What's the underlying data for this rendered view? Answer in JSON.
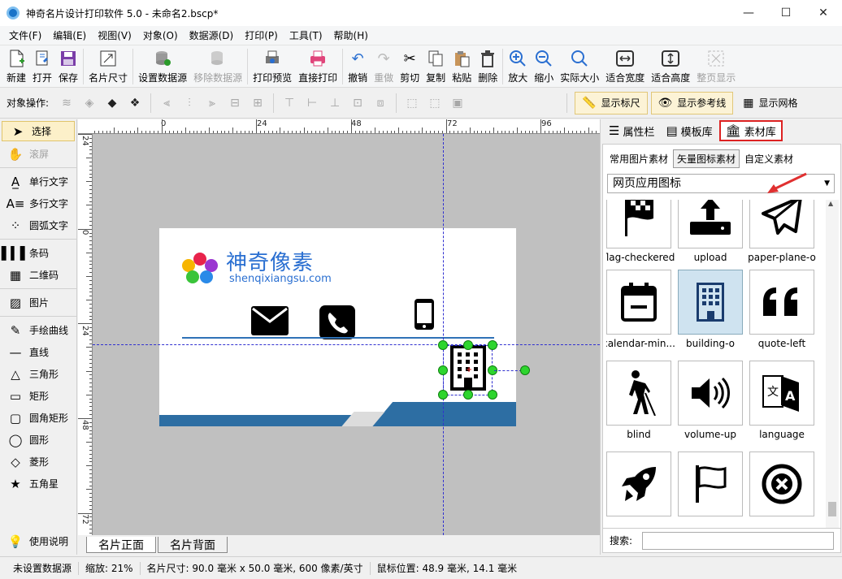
{
  "window": {
    "title": "神奇名片设计打印软件 5.0 - 未命名2.bscp*",
    "minimize": "—",
    "maximize": "☐",
    "close": "✕"
  },
  "menu": [
    "文件(F)",
    "编辑(E)",
    "视图(V)",
    "对象(O)",
    "数据源(D)",
    "打印(P)",
    "工具(T)",
    "帮助(H)"
  ],
  "toolbar": {
    "new": "新建",
    "open": "打开",
    "save": "保存",
    "card_size": "名片尺寸",
    "set_datasource": "设置数据源",
    "remove_datasource": "移除数据源",
    "print_preview": "打印预览",
    "direct_print": "直接打印",
    "undo": "撤销",
    "redo": "重做",
    "cut": "剪切",
    "copy": "复制",
    "paste": "粘贴",
    "delete": "删除",
    "zoom_in": "放大",
    "zoom_out": "缩小",
    "actual_size": "实际大小",
    "fit_width": "适合宽度",
    "fit_height": "适合高度",
    "fit_page": "整页显示"
  },
  "objbar": {
    "label": "对象操作:",
    "show_ruler": "显示标尺",
    "show_guides": "显示参考线",
    "show_grid": "显示网格"
  },
  "tools": {
    "select": "选择",
    "scroll": "滚屏",
    "single_text": "单行文字",
    "multi_text": "多行文字",
    "arc_text": "圆弧文字",
    "barcode": "条码",
    "qrcode": "二维码",
    "image": "图片",
    "freehand": "手绘曲线",
    "line": "直线",
    "triangle": "三角形",
    "rect": "矩形",
    "round_rect": "圆角矩形",
    "ellipse": "圆形",
    "diamond": "菱形",
    "star": "五角星",
    "help": "使用说明"
  },
  "ruler": {
    "h_labels": [
      "0",
      "24",
      "48",
      "72",
      "96"
    ],
    "v_labels": [
      "24",
      "0",
      "24",
      "48",
      "72"
    ]
  },
  "card": {
    "brand": "神奇像素",
    "url": "shenqixiangsu.com"
  },
  "sheets": {
    "front": "名片正面",
    "back": "名片背面"
  },
  "right_panel": {
    "tabs": {
      "properties": "属性栏",
      "templates": "模板库",
      "assets": "素材库"
    },
    "sub_tabs": {
      "common": "常用图片素材",
      "vector": "矢量图标素材",
      "custom": "自定义素材"
    },
    "category": "网页应用图标",
    "icons": [
      "flag-checkered",
      "upload",
      "paper-plane-o",
      "calendar-min...",
      "building-o",
      "quote-left",
      "blind",
      "volume-up",
      "language",
      "",
      "",
      ""
    ],
    "search_label": "搜索:"
  },
  "status": {
    "datasource": "未设置数据源",
    "zoom": "缩放: 21%",
    "card_size": "名片尺寸: 90.0 毫米 x 50.0 毫米, 600 像素/英寸",
    "mouse_pos": "鼠标位置: 48.9 毫米, 14.1 毫米"
  },
  "colors": {
    "accent_blue": "#2a6fd1",
    "card_band": "#2d6ea3",
    "handle_green": "#2ed52e",
    "highlight_red": "#dd2222"
  }
}
